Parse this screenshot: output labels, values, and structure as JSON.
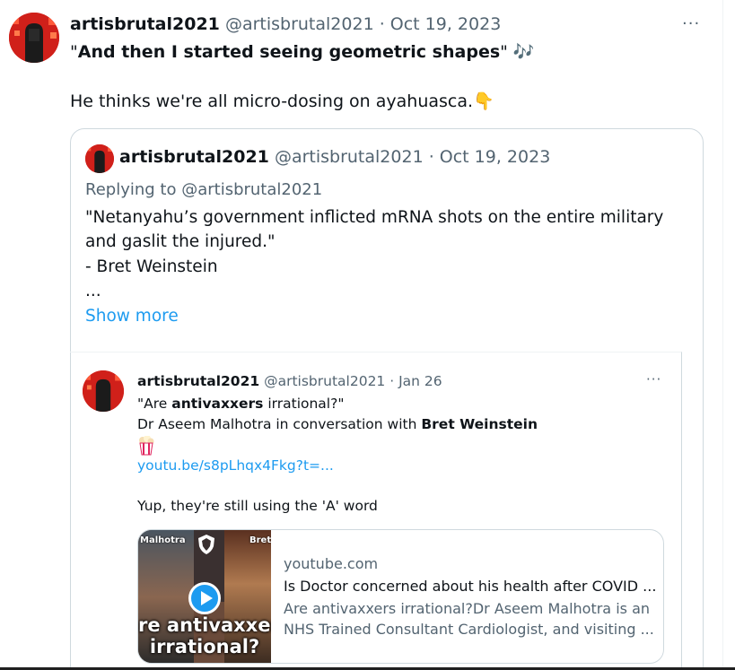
{
  "main_tweet": {
    "display_name": "artisbrutal2021",
    "handle_date": "@artisbrutal2021 · Oct 19, 2023",
    "more": "···",
    "line1_prefix": "\"",
    "line1_bold": "And then I started seeing geometric shapes",
    "line1_suffix": "\" ",
    "line1_emoji": "🎶",
    "line2": "He thinks we're all micro-dosing on ayahuasca.",
    "line2_emoji": "👇"
  },
  "quoted_tweet": {
    "display_name": "artisbrutal2021",
    "handle_date": "@artisbrutal2021 · Oct 19, 2023",
    "replying_to": "Replying to @artisbrutal2021",
    "lines": [
      "\"Netanyahu’s government inflicted mRNA shots on the entire military",
      "and gaslit the injured.\"",
      "- Bret Weinstein",
      "..."
    ],
    "show_more": "Show more"
  },
  "nested_tweet": {
    "display_name": "artisbrutal2021",
    "handle_date": "@artisbrutal2021 · Jan 26",
    "more": "···",
    "line1_a": "\"Are ",
    "line1_bold": "antivaxxers",
    "line1_b": " irrational?\"",
    "line2_a": "Dr Aseem Malhotra in conversation with ",
    "line2_bold": "Bret Weinstein",
    "link": "youtu.be/s8pLhqx4Fkg?t=...",
    "line_last": "Yup, they're still using the 'A' word"
  },
  "link_card": {
    "thumb_label_left": "Malhotra",
    "thumb_label_right": "Bret",
    "thumb_caption_1": "re antivaxxer",
    "thumb_caption_2": "irrational?",
    "domain": "youtube.com",
    "title": "Is Doctor concerned about his health after COVID ...",
    "description_1": "Are antivaxxers irrational?Dr Aseem Malhotra is an",
    "description_2": "NHS Trained Consultant Cardiologist, and visiting ..."
  },
  "icons": [
    "avatar-icon",
    "more-icon",
    "music-notes-icon",
    "point-down-icon",
    "popcorn-icon",
    "play-icon",
    "shield-logo-icon"
  ],
  "colors": {
    "link": "#1d9bf0",
    "muted": "#536471",
    "text": "#0f1419",
    "border": "#cfd9de"
  }
}
